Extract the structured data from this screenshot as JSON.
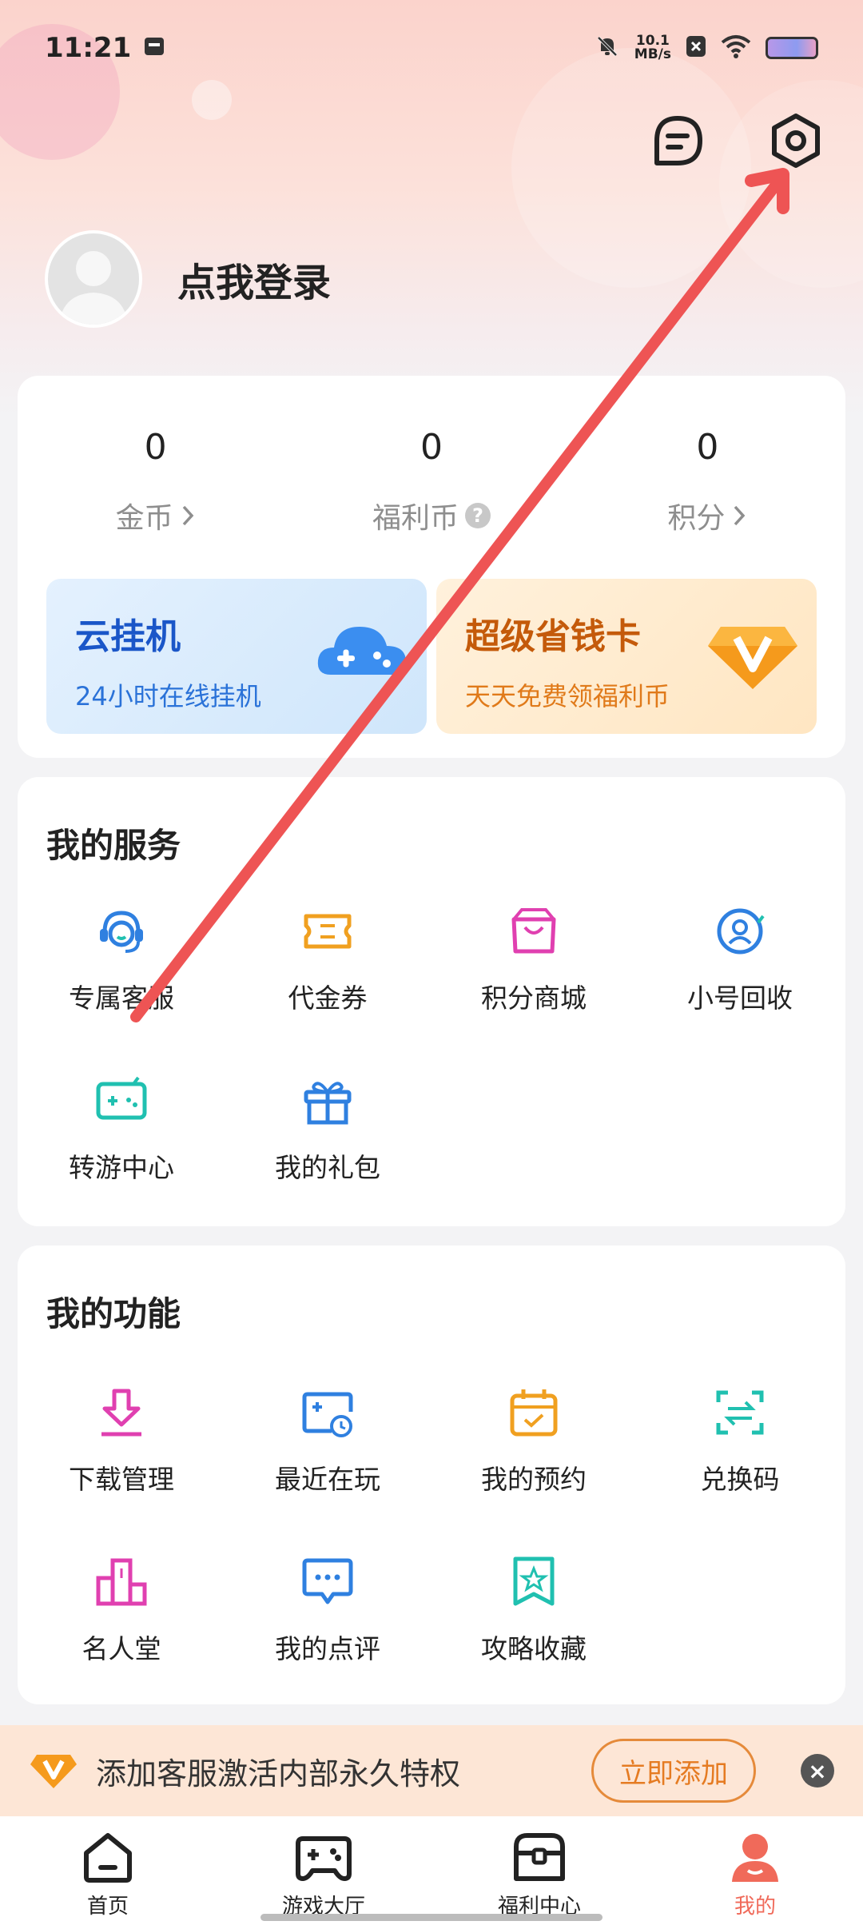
{
  "status_bar": {
    "time": "11:21",
    "net_speed_value": "10.1",
    "net_speed_unit": "MB/s"
  },
  "profile": {
    "login_text": "点我登录"
  },
  "stats": [
    {
      "value": "0",
      "label": "金币",
      "suffix_icon": "chevron-right-icon"
    },
    {
      "value": "0",
      "label": "福利币",
      "suffix_icon": "question-icon"
    },
    {
      "value": "0",
      "label": "积分",
      "suffix_icon": "chevron-right-icon"
    }
  ],
  "promos": {
    "cloud": {
      "title": "云挂机",
      "subtitle": "24小时在线挂机",
      "color": "#1a56c8"
    },
    "saver": {
      "title": "超级省钱卡",
      "subtitle": "天天免费领福利币",
      "color": "#c45a0a"
    }
  },
  "services": {
    "title": "我的服务",
    "items": [
      {
        "label": "专属客服",
        "icon": "headset-icon"
      },
      {
        "label": "代金券",
        "icon": "coupon-icon"
      },
      {
        "label": "积分商城",
        "icon": "shopping-bag-icon"
      },
      {
        "label": "小号回收",
        "icon": "account-recycle-icon"
      },
      {
        "label": "转游中心",
        "icon": "game-transfer-icon"
      },
      {
        "label": "我的礼包",
        "icon": "gift-icon"
      }
    ]
  },
  "functions": {
    "title": "我的功能",
    "items": [
      {
        "label": "下载管理",
        "icon": "download-icon"
      },
      {
        "label": "最近在玩",
        "icon": "recent-games-icon"
      },
      {
        "label": "我的预约",
        "icon": "calendar-check-icon"
      },
      {
        "label": "兑换码",
        "icon": "exchange-code-icon"
      },
      {
        "label": "名人堂",
        "icon": "podium-icon"
      },
      {
        "label": "我的点评",
        "icon": "comment-icon"
      },
      {
        "label": "攻略收藏",
        "icon": "bookmark-star-icon"
      }
    ]
  },
  "banner": {
    "text": "添加客服激活内部永久特权",
    "button": "立即添加",
    "close": "×"
  },
  "tabs": [
    {
      "label": "首页",
      "icon": "home-icon",
      "active": false
    },
    {
      "label": "游戏大厅",
      "icon": "gamepad-icon",
      "active": false
    },
    {
      "label": "福利中心",
      "icon": "treasure-chest-icon",
      "active": false
    },
    {
      "label": "我的",
      "icon": "person-icon",
      "active": true
    }
  ],
  "colors": {
    "accent": "#f06a5a",
    "annotation_arrow": "#ee5454",
    "blue_icon": "#2f80e0",
    "orange_icon": "#f0a020",
    "pink_icon": "#e040b0",
    "teal_icon": "#20c0b0"
  }
}
